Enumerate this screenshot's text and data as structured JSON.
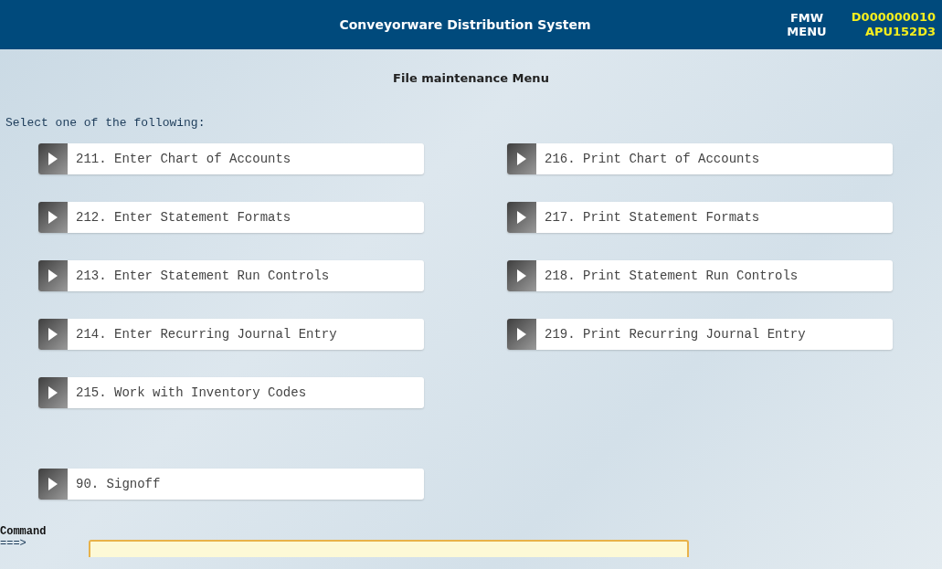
{
  "header": {
    "title": "Conveyorware Distribution System",
    "menu_code": [
      "FMW",
      "MENU"
    ],
    "session_ids": [
      "D000000010",
      "APU152D3"
    ]
  },
  "page_title": "File maintenance Menu",
  "prompt": "Select one of the following:",
  "columns": [
    [
      {
        "label": "211. Enter Chart of Accounts"
      },
      {
        "label": "212. Enter Statement Formats"
      },
      {
        "label": "213. Enter Statement Run Controls"
      },
      {
        "label": "214. Enter Recurring Journal Entry"
      },
      {
        "label": "215. Work with Inventory Codes"
      }
    ],
    [
      {
        "label": "216. Print Chart of Accounts"
      },
      {
        "label": "217. Print Statement Formats"
      },
      {
        "label": "218. Print Statement Run Controls"
      },
      {
        "label": "219. Print Recurring Journal Entry"
      }
    ]
  ],
  "signoff": {
    "label": "90. Signoff"
  },
  "command": {
    "label": "Command",
    "arrow": "===>"
  }
}
